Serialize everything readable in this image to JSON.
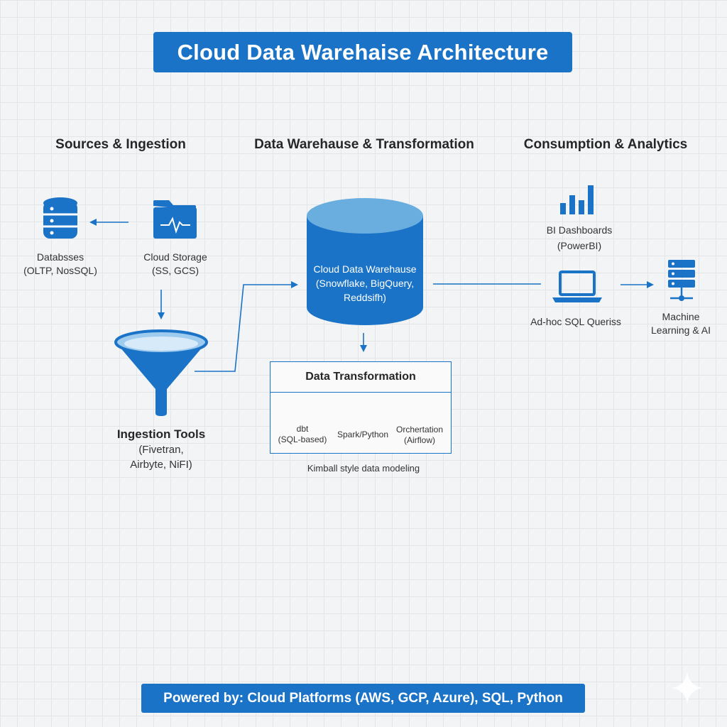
{
  "title": "Cloud Data Warehaise Architecture",
  "columns": {
    "sources": "Sources & Ingestion",
    "warehouse": "Data Warehause & Transformation",
    "consumption": "Consumption & Analytics"
  },
  "sources": {
    "databases": {
      "line1": "Databsses",
      "line2": "(OLTP, NosSQL)"
    },
    "cloud_storage": {
      "line1": "Cloud Storage",
      "line2": "(SS, GCS)"
    },
    "ingestion_tools": {
      "title": "Ingestion Tools",
      "line1": "(Fivetran,",
      "line2": "Airbyte, NiFI)"
    }
  },
  "warehouse": {
    "line1": "Cloud Data Warehause",
    "line2": "(Snowflake, BigQuery,",
    "line3": "Reddsifh)"
  },
  "transformation": {
    "title": "Data Transformation",
    "items": [
      {
        "icon": "code-icon",
        "line1": "dbt",
        "line2": "(SQL-based)"
      },
      {
        "icon": "gears-icon",
        "line1": "Spark/Python",
        "line2": ""
      },
      {
        "icon": "calendar-icon",
        "line1": "Orchertation",
        "line2": "(Airflow)"
      }
    ],
    "caption": "Kimball style data modeling"
  },
  "consumption": {
    "bi": {
      "line1": "BI Dashboards",
      "line2": "(PowerBI)"
    },
    "sql": {
      "line1": "Ad-hoc SQL Queriss"
    },
    "ml": {
      "line1": "Machine",
      "line2": "Learning & AI"
    }
  },
  "footer": "Powered by: Cloud Platforms (AWS, GCP, Azure), SQL, Python",
  "colors": {
    "accent": "#1a73c6",
    "accent_light": "#6aaee0",
    "background": "#f3f4f6"
  }
}
